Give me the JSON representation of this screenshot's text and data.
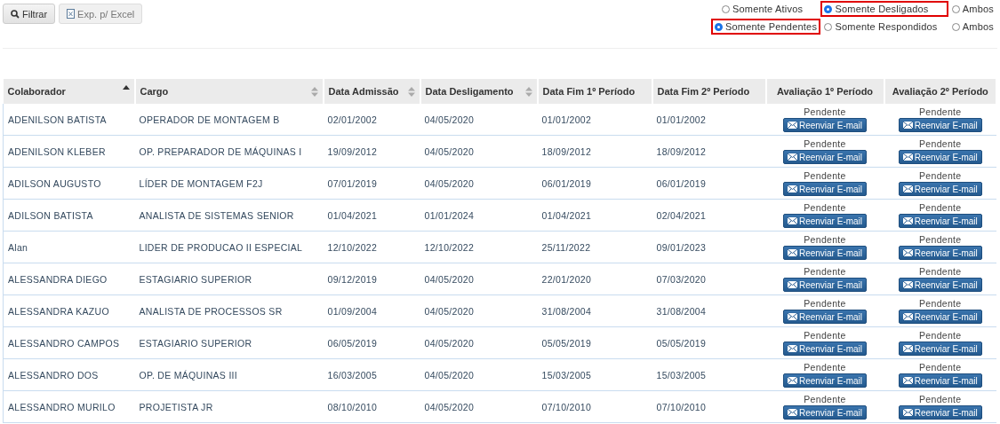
{
  "toolbar": {
    "buttons": [
      {
        "kind": "search",
        "label": "Filtrar"
      },
      {
        "kind": "excel",
        "label": "Exp. p/ Excel"
      }
    ]
  },
  "filters": [
    [
      {
        "label": "Somente Ativos",
        "selected": false
      },
      {
        "label": "Somente Desligados",
        "selected": true
      },
      {
        "label": "Ambos",
        "selected": false
      }
    ],
    [
      {
        "label": "Somente Pendentes",
        "selected": true
      },
      {
        "label": "Somente Respondidos",
        "selected": false
      },
      {
        "label": "Ambos",
        "selected": false
      }
    ]
  ],
  "table": {
    "columns": [
      {
        "label": "Colaborador",
        "sortable": true,
        "sorted": true
      },
      {
        "label": "Cargo",
        "sortable": true,
        "sorted": false
      },
      {
        "label": "Data Admissão",
        "sortable": true,
        "sorted": false
      },
      {
        "label": "Data Desligamento",
        "sortable": true,
        "sorted": false
      },
      {
        "label": "Data Fim 1º Período",
        "sortable": false,
        "sorted": false
      },
      {
        "label": "Data Fim 2º Período",
        "sortable": false,
        "sorted": false
      },
      {
        "label": "Avaliação 1º Período",
        "sortable": false,
        "sorted": false
      },
      {
        "label": "Avaliação 2º Período",
        "sortable": false,
        "sorted": false
      }
    ],
    "rows": [
      {
        "cells": [
          "ADENILSON BATISTA",
          "OPERADOR DE MONTAGEM B",
          "02/01/2002",
          "04/05/2020",
          "01/01/2002",
          "01/01/2002"
        ],
        "evaluations": [
          {
            "status": "Pendente",
            "button": "Reenviar E-mail"
          },
          {
            "status": "Pendente",
            "button": "Reenviar E-mail"
          }
        ]
      },
      {
        "cells": [
          "ADENILSON KLEBER",
          "OP. PREPARADOR DE MÁQUINAS I",
          "19/09/2012",
          "04/05/2020",
          "18/09/2012",
          "18/09/2012"
        ],
        "evaluations": [
          {
            "status": "Pendente",
            "button": "Reenviar E-mail"
          },
          {
            "status": "Pendente",
            "button": "Reenviar E-mail"
          }
        ]
      },
      {
        "cells": [
          "ADILSON AUGUSTO",
          "LÍDER DE MONTAGEM F2J",
          "07/01/2019",
          "04/05/2020",
          "06/01/2019",
          "06/01/2019"
        ],
        "evaluations": [
          {
            "status": "Pendente",
            "button": "Reenviar E-mail"
          },
          {
            "status": "Pendente",
            "button": "Reenviar E-mail"
          }
        ]
      },
      {
        "cells": [
          "ADILSON BATISTA",
          "ANALISTA DE SISTEMAS SENIOR",
          "01/04/2021",
          "01/01/2024",
          "01/04/2021",
          "02/04/2021"
        ],
        "evaluations": [
          {
            "status": "Pendente",
            "button": "Reenviar E-mail"
          },
          {
            "status": "Pendente",
            "button": "Reenviar E-mail"
          }
        ]
      },
      {
        "cells": [
          "Alan",
          "LIDER DE PRODUCAO II ESPECIAL",
          "12/10/2022",
          "12/10/2022",
          "25/11/2022",
          "09/01/2023"
        ],
        "evaluations": [
          {
            "status": "Pendente",
            "button": "Reenviar E-mail"
          },
          {
            "status": "Pendente",
            "button": "Reenviar E-mail"
          }
        ]
      },
      {
        "cells": [
          "ALESSANDRA DIEGO",
          "ESTAGIARIO SUPERIOR",
          "09/12/2019",
          "04/05/2020",
          "22/01/2020",
          "07/03/2020"
        ],
        "evaluations": [
          {
            "status": "Pendente",
            "button": "Reenviar E-mail"
          },
          {
            "status": "Pendente",
            "button": "Reenviar E-mail"
          }
        ]
      },
      {
        "cells": [
          "ALESSANDRA KAZUO",
          "ANALISTA DE PROCESSOS SR",
          "01/09/2004",
          "04/05/2020",
          "31/08/2004",
          "31/08/2004"
        ],
        "evaluations": [
          {
            "status": "Pendente",
            "button": "Reenviar E-mail"
          },
          {
            "status": "Pendente",
            "button": "Reenviar E-mail"
          }
        ]
      },
      {
        "cells": [
          "ALESSANDRO CAMPOS",
          "ESTAGIARIO SUPERIOR",
          "06/05/2019",
          "04/05/2020",
          "05/05/2019",
          "05/05/2019"
        ],
        "evaluations": [
          {
            "status": "Pendente",
            "button": "Reenviar E-mail"
          },
          {
            "status": "Pendente",
            "button": "Reenviar E-mail"
          }
        ]
      },
      {
        "cells": [
          "ALESSANDRO DOS",
          "OP. DE MÁQUINAS III",
          "16/03/2005",
          "04/05/2020",
          "15/03/2005",
          "15/03/2005"
        ],
        "evaluations": [
          {
            "status": "Pendente",
            "button": "Reenviar E-mail"
          },
          {
            "status": "Pendente",
            "button": "Reenviar E-mail"
          }
        ]
      },
      {
        "cells": [
          "ALESSANDRO MURILO",
          "PROJETISTA JR",
          "08/10/2010",
          "04/05/2020",
          "07/10/2010",
          "07/10/2010"
        ],
        "evaluations": [
          {
            "status": "Pendente",
            "button": "Reenviar E-mail"
          },
          {
            "status": "Pendente",
            "button": "Reenviar E-mail"
          }
        ]
      }
    ]
  }
}
